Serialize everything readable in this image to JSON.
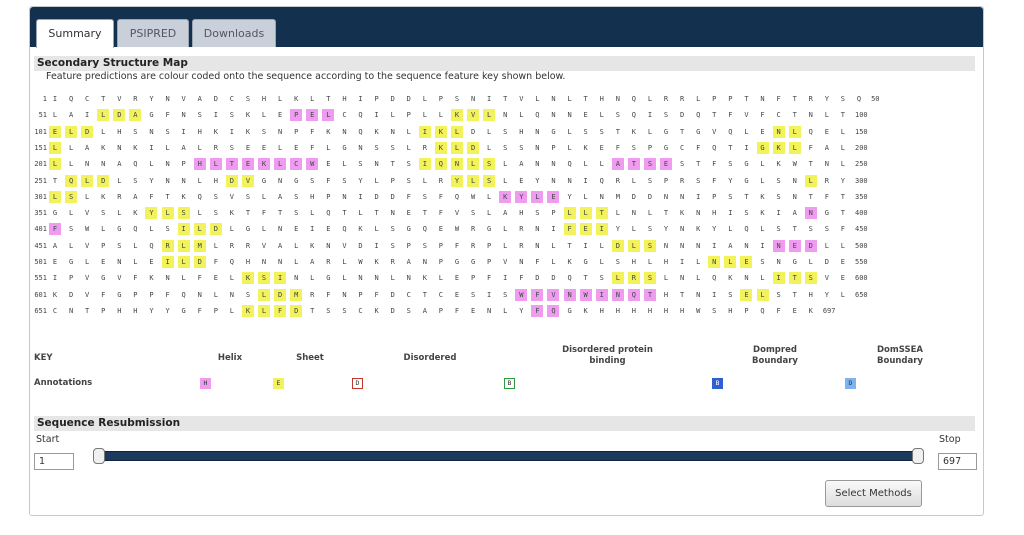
{
  "tabs": [
    {
      "label": "Summary",
      "active": true
    },
    {
      "label": "PSIPRED",
      "active": false
    },
    {
      "label": "Downloads",
      "active": false
    }
  ],
  "secondary_structure": {
    "heading": "Secondary Structure Map",
    "description": "Feature predictions are colour coded onto the sequence according to the sequence feature key shown below.",
    "row_size": 50,
    "rows": [
      {
        "start": "1",
        "end": "50",
        "seq": "IQCTVRYNVADCSHLKLTHIPDDLPSNITVLNLTHNQLRRLPPTNFTRYSQ",
        "ss": "-----------------------------------------------------"
      },
      {
        "start": "51",
        "end": "100",
        "seq": "LAILDAGFNSISKLEPELCQILPLLKVLNLQNNELSQISDQTFVFCTNLT",
        "ss": "---EEE---------HHH-------EEE--------------------"
      },
      {
        "start": "101",
        "end": "150",
        "seq": "ELDLHSNSIHKIKSNPFKNQKNLIKLDLSHNGLSSTKLGTGVQLENLQEL",
        "ss": "EEE--------------------EEE-------------------EE"
      },
      {
        "start": "151",
        "end": "200",
        "seq": "LLAKNKILALRSEELEFLGNSSLRKLDLSSNPLKEFSPGCFQTIGKLFAL",
        "ss": "E-----------------------EEE-----------------EEE"
      },
      {
        "start": "201",
        "end": "250",
        "seq": "LLNNAQLNPHLTEKLCWELSNTSIQNLSLANNQLLATSESTFSGLKWTNL",
        "ss": "E--------HHHHHHHH------EEEEE-------HHHH--------"
      },
      {
        "start": "251",
        "end": "300",
        "seq": "TQLDLSYNNLHDVGNGSFSYLPSLRYLSLEYNNIQRLSPRSFYGLSNLRY",
        "ss": "-EEE-------EE------------EEE-------------------E"
      },
      {
        "start": "301",
        "end": "350",
        "seq": "LSLKRAFTKQSVSLASHPNIDDFSFQWLKYLEYLNMDDNNIPSTKSNTFT",
        "ss": "EE--------------------------HHHH------------------"
      },
      {
        "start": "351",
        "end": "400",
        "seq": "GLVSLKYLSLSKTFTSLQTLTNETFVSLAHSPLLTLNLTKNHISKIANGT",
        "ss": "------EEE-----------------------EEE------------H"
      },
      {
        "start": "401",
        "end": "450",
        "seq": "FSWLGQLSILDLGLNEIEQKLSGQEWRGLRNIFEIYLSYNKYLQLSTSSF",
        "ss": "H-------EEE---------------------EEE-------------"
      },
      {
        "start": "451",
        "end": "500",
        "seq": "ALVPSLQRLMLRRVALKNVDISPSPFRPLRNLTILDLSNNNIANINEDLL",
        "ss": "-------EEE-------------------------EEE-------HHH-"
      },
      {
        "start": "501",
        "end": "550",
        "seq": "EGLENLEILDFQHNNLARLWKRANPGGPVNFLKGLSHLHILNLESNGLDE",
        "ss": "-------EEE-------------------------------EEE------"
      },
      {
        "start": "551",
        "end": "600",
        "seq": "IPVGVFKNLFELKSINLGLNNLNKLEPFIFDDQTSLRSLNLQKNLITSVE",
        "ss": "------------EEE--------------------EEE-------EEE"
      },
      {
        "start": "601",
        "end": "650",
        "seq": "KDVFGPPFQNLNSLDMRFNPFDCTCESISWFVNWINQTHTNISELSTHYL",
        "ss": "-------------EEE-------------HHHHHHHHH-----EE------"
      },
      {
        "start": "651",
        "end": "697",
        "seq": "CNTPHHYYGFPLKLFDTSSCKDSAPFENLYFQGKHHHHHHWSHPQFEK",
        "ss": "------------EEEE--------------HH-------------------"
      }
    ]
  },
  "key": {
    "label": "KEY",
    "annotations_label": "Annotations",
    "items": [
      {
        "label": "Helix",
        "symbol": "H",
        "bg": "#ef9cf0",
        "border": "#ef9cf0"
      },
      {
        "label": "Sheet",
        "symbol": "E",
        "bg": "#f2f25a",
        "border": "#f2f25a"
      },
      {
        "label": "Disordered",
        "symbol": "D",
        "bg": "#ffffff",
        "border": "#c0392b"
      },
      {
        "label": "Disordered protein binding",
        "symbol": "B",
        "bg": "#ffffff",
        "border": "#2e9b3a"
      },
      {
        "label": "Dompred Boundary",
        "symbol": "B",
        "bg": "#2f5fd0",
        "border": "#2f5fd0"
      },
      {
        "label": "DomSSEA Boundary",
        "symbol": "D",
        "bg": "#7fb2f0",
        "border": "#7fb2f0"
      }
    ]
  },
  "resubmission": {
    "heading": "Sequence Resubmission",
    "start_label": "Start",
    "stop_label": "Stop",
    "start_value": "1",
    "stop_value": "697",
    "button_label": "Select Methods"
  },
  "colors": {
    "header": "#14304f",
    "helix": "#ef9cf0",
    "sheet": "#f2f25a",
    "slider": "#1b3a5c"
  }
}
